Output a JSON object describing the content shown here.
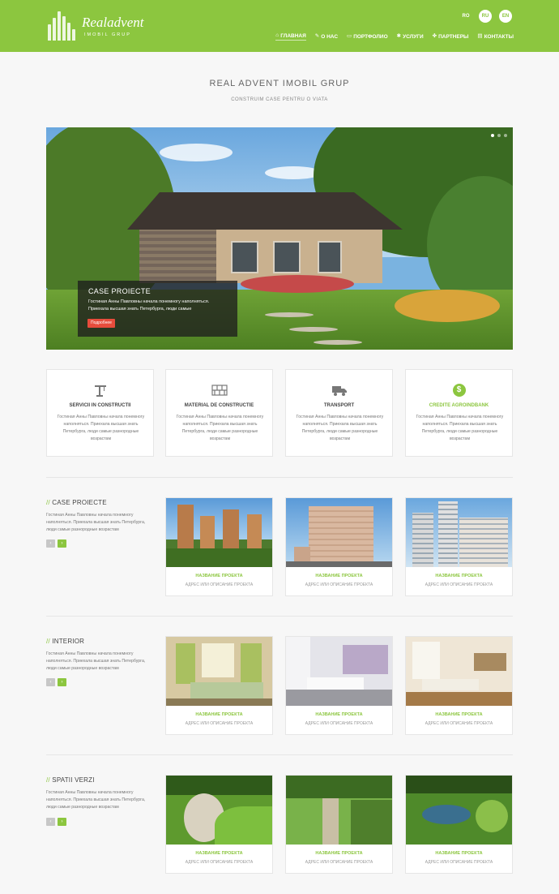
{
  "header": {
    "logo_name": "Realadvent",
    "logo_sub": "IMOBIL GRUP",
    "languages": [
      {
        "code": "RO",
        "active": false
      },
      {
        "code": "RU",
        "active": true
      },
      {
        "code": "EN",
        "active": true
      }
    ],
    "nav": [
      {
        "label": "ГЛАВНАЯ",
        "icon": "home-icon",
        "active": true
      },
      {
        "label": "О НАС",
        "icon": "pencil-icon",
        "active": false
      },
      {
        "label": "ПОРТФОЛИО",
        "icon": "monitor-icon",
        "active": false
      },
      {
        "label": "УСЛУГИ",
        "icon": "gear-icon",
        "active": false
      },
      {
        "label": "ПАРТНЕРЫ",
        "icon": "handshake-icon",
        "active": false
      },
      {
        "label": "КОНТАКТЫ",
        "icon": "contact-icon",
        "active": false
      }
    ]
  },
  "hero": {
    "title": "REAL ADVENT IMOBIL GRUP",
    "subtitle": "CONSTRUIM CASE PENTRU O VIATA"
  },
  "slider": {
    "caption_title": "CASE PROIECTE",
    "caption_text": "Гостиная Анны Павловны начала понемногу наполняться. Приехала высшая знать Петербурга, люди самые",
    "button_label": "Подробнее",
    "slide_count": 3,
    "active_slide": 1
  },
  "services": [
    {
      "title": "SERVICII IN CONSTRUCTII",
      "icon": "crane-icon",
      "highlight": false,
      "text": "Гостиная Анны Павловны начала понемногу наполняться. Приехала высшая знать Петербурга, люди самые разнородные возрастам"
    },
    {
      "title": "MATERIAL DE CONSTRUCTIE",
      "icon": "bricks-icon",
      "highlight": false,
      "text": "Гостиная Анны Павловны начала понемногу наполняться. Приехала высшая знать Петербурга, люди самые разнородные возрастам"
    },
    {
      "title": "TRANSPORT",
      "icon": "truck-icon",
      "highlight": false,
      "text": "Гостиная Анны Павловны начала понемногу наполняться. Приехала высшая знать Петербурга, люди самые разнородные возрастам"
    },
    {
      "title": "CREDITE AGROINDBANK",
      "icon": "dollar-icon",
      "highlight": true,
      "text": "Гостиная Анны Павловны начала понемногу наполняться. Приехала высшая знать Петербурга, люди самые разнородные возрастам"
    }
  ],
  "sections": [
    {
      "slashes": "//",
      "title": "CASE PROIECTE",
      "text": "Гостиная Анны Павловны начала понемногу наполняться. Приехала высшая знать Петербурга, люди самые разнородные возрастам",
      "cards": [
        {
          "name": "НАЗВАНИЕ ПРОЕКТА",
          "desc": "АДРЕС ИЛИ ОПИСАНИЕ ПРОЕКТА"
        },
        {
          "name": "НАЗВАНИЕ ПРОЕКТА",
          "desc": "АДРЕС ИЛИ ОПИСАНИЕ ПРОЕКТА"
        },
        {
          "name": "НАЗВАНИЕ ПРОЕКТА",
          "desc": "АДРЕС ИЛИ ОПИСАНИЕ ПРОЕКТА"
        }
      ]
    },
    {
      "slashes": "//",
      "title": "INTERIOR",
      "text": "Гостиная Анны Павловны начала понемногу наполняться. Приехала высшая знать Петербурга, люди самые разнородные возрастам",
      "cards": [
        {
          "name": "НАЗВАНИЕ ПРОЕКТА",
          "desc": "АДРЕС ИЛИ ОПИСАНИЕ ПРОЕКТА"
        },
        {
          "name": "НАЗВАНИЕ ПРОЕКТА",
          "desc": "АДРЕС ИЛИ ОПИСАНИЕ ПРОЕКТА"
        },
        {
          "name": "НАЗВАНИЕ ПРОЕКТА",
          "desc": "АДРЕС ИЛИ ОПИСАНИЕ ПРОЕКТА"
        }
      ]
    },
    {
      "slashes": "//",
      "title": "SPATII VERZI",
      "text": "Гостиная Анны Павловны начала понемногу наполняться. Приехала высшая знать Петербурга, люди самые разнородные возрастам",
      "cards": [
        {
          "name": "НАЗВАНИЕ ПРОЕКТА",
          "desc": "АДРЕС ИЛИ ОПИСАНИЕ ПРОЕКТА"
        },
        {
          "name": "НАЗВАНИЕ ПРОЕКТА",
          "desc": "АДРЕС ИЛИ ОПИСАНИЕ ПРОЕКТА"
        },
        {
          "name": "НАЗВАНИЕ ПРОЕКТА",
          "desc": "АДРЕС ИЛИ ОПИСАНИЕ ПРОЕКТА"
        }
      ]
    }
  ],
  "arrows": {
    "prev": "‹",
    "next": "›"
  },
  "colors": {
    "accent": "#8cc63f",
    "button_red": "#e74c3c"
  }
}
